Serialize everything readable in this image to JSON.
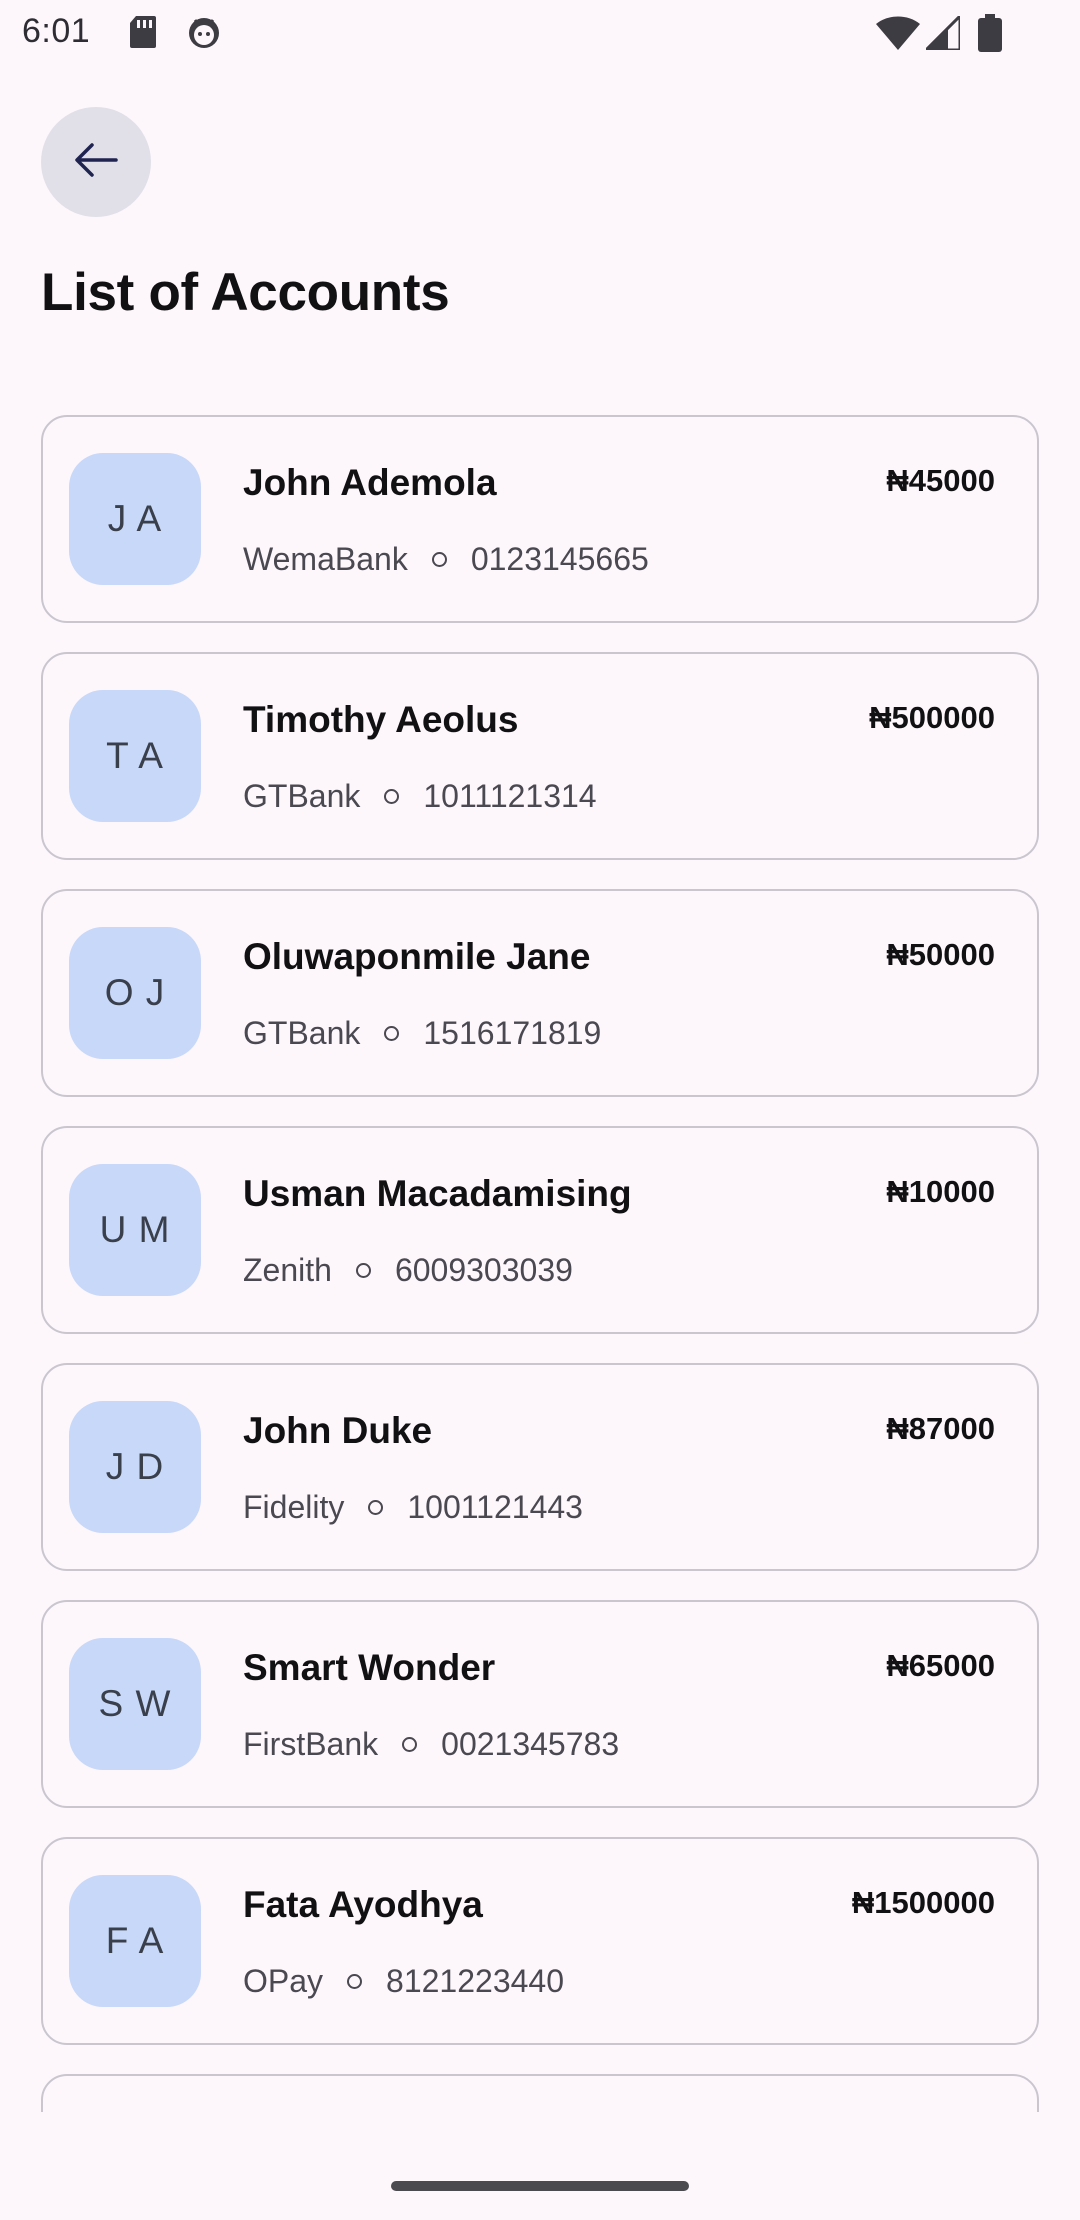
{
  "status_bar": {
    "time": "6:01",
    "left_icons": [
      "sd-card-icon",
      "android-face-icon"
    ],
    "right_icons": [
      "wifi-icon",
      "cell-signal-icon",
      "battery-icon"
    ]
  },
  "header": {
    "back_icon": "arrow-left-icon",
    "title": "List of Accounts"
  },
  "accounts": [
    {
      "initials": "J A",
      "name": "John Ademola",
      "bank": "WemaBank",
      "number": "0123145665",
      "amount": "₦45000"
    },
    {
      "initials": "T A",
      "name": "Timothy Aeolus",
      "bank": "GTBank",
      "number": "1011121314",
      "amount": "₦500000"
    },
    {
      "initials": "O J",
      "name": "Oluwaponmile Jane",
      "bank": "GTBank",
      "number": "1516171819",
      "amount": "₦50000"
    },
    {
      "initials": "U M",
      "name": "Usman Macadamising",
      "bank": "Zenith",
      "number": "6009303039",
      "amount": "₦10000"
    },
    {
      "initials": "J D",
      "name": "John Duke",
      "bank": "Fidelity",
      "number": "1001121443",
      "amount": "₦87000"
    },
    {
      "initials": "S W",
      "name": "Smart Wonder",
      "bank": "FirstBank",
      "number": "0021345783",
      "amount": "₦65000"
    },
    {
      "initials": "F A",
      "name": "Fata Ayodhya",
      "bank": "OPay",
      "number": "8121223440",
      "amount": "₦1500000"
    },
    {
      "initials": "",
      "name": "",
      "bank": "",
      "number": "",
      "amount": ""
    }
  ],
  "colors": {
    "background": "#fdf7fc",
    "avatar_bg": "#c8d8f8",
    "back_button_bg": "#e1e0e8",
    "card_border": "#c9c6cf"
  }
}
